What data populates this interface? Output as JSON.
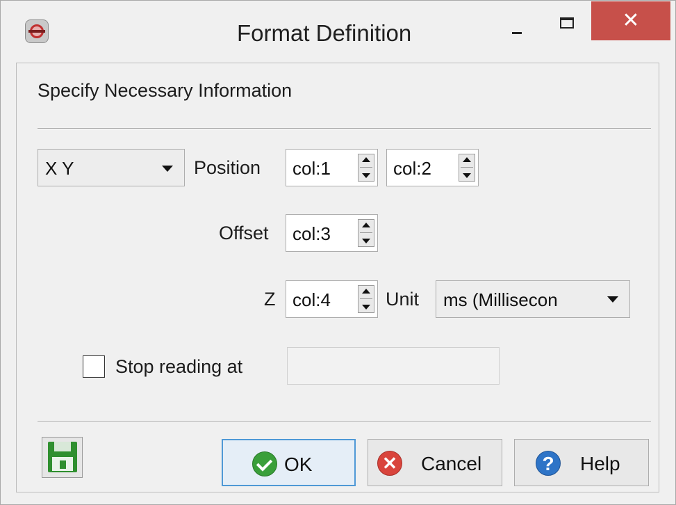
{
  "window": {
    "title": "Format Definition",
    "icon": "app-logo-icon",
    "controls": {
      "minimize": "minimize-icon",
      "maximize": "maximize-icon",
      "close": "✕"
    }
  },
  "heading": "Specify Necessary Information",
  "coordinate_type": {
    "selected": "X Y"
  },
  "position": {
    "label": "Position",
    "x_column": "col:1",
    "y_column": "col:2"
  },
  "offset": {
    "label": "Offset",
    "column": "col:3"
  },
  "z": {
    "label": "Z",
    "column": "col:4"
  },
  "unit": {
    "label": "Unit",
    "selected": "ms (Millisecon"
  },
  "stop_reading": {
    "label": "Stop reading at",
    "checked": false,
    "value": ""
  },
  "footer": {
    "save_icon": "floppy-disk-icon",
    "ok_label": "OK",
    "cancel_label": "Cancel",
    "help_label": "Help",
    "cancel_glyph": "✕",
    "help_glyph": "?"
  },
  "colors": {
    "close_button": "#c7504a",
    "ok_icon": "#3a9f3a",
    "cancel_icon": "#d9443c",
    "help_icon": "#2e74c7",
    "default_button_border": "#4f99d6"
  }
}
